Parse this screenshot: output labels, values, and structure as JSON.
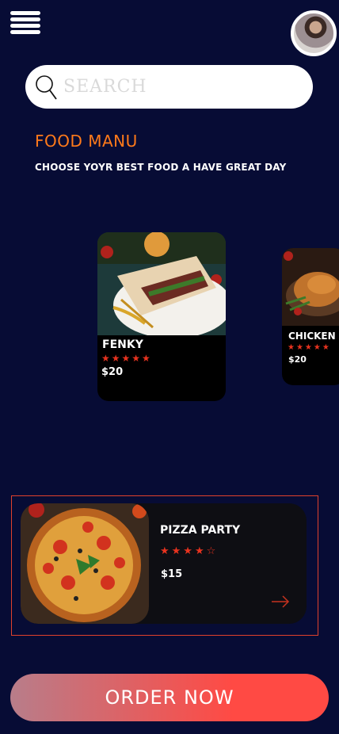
{
  "header": {
    "menu_icon": "hamburger-menu-icon",
    "avatar_icon": "user-avatar"
  },
  "search": {
    "placeholder": "SEARCH",
    "icon": "search-icon"
  },
  "section": {
    "title": "FOOD MANU",
    "subtitle": "CHOOSE YOYR BEST FOOD A HAVE GREAT DAY"
  },
  "carousel": [
    {
      "name": "FENKY",
      "rating": 5,
      "stars": "★★★★★",
      "price": "$20"
    },
    {
      "name": "CHICKEN",
      "rating": 5,
      "stars": "★★★★★",
      "price": "$20"
    }
  ],
  "featured": {
    "name": "PIZZA PARTY",
    "rating": 4,
    "stars": "★★★★☆",
    "price": "$15",
    "arrow_icon": "arrow-right-icon"
  },
  "order_button": {
    "label": "ORDER NOW"
  },
  "colors": {
    "background": "#070c35",
    "accent_orange": "#ff7a1a",
    "star_red": "#e8331f",
    "button_gradient_start": "#b87d8a",
    "button_gradient_end": "#ff4a44"
  }
}
